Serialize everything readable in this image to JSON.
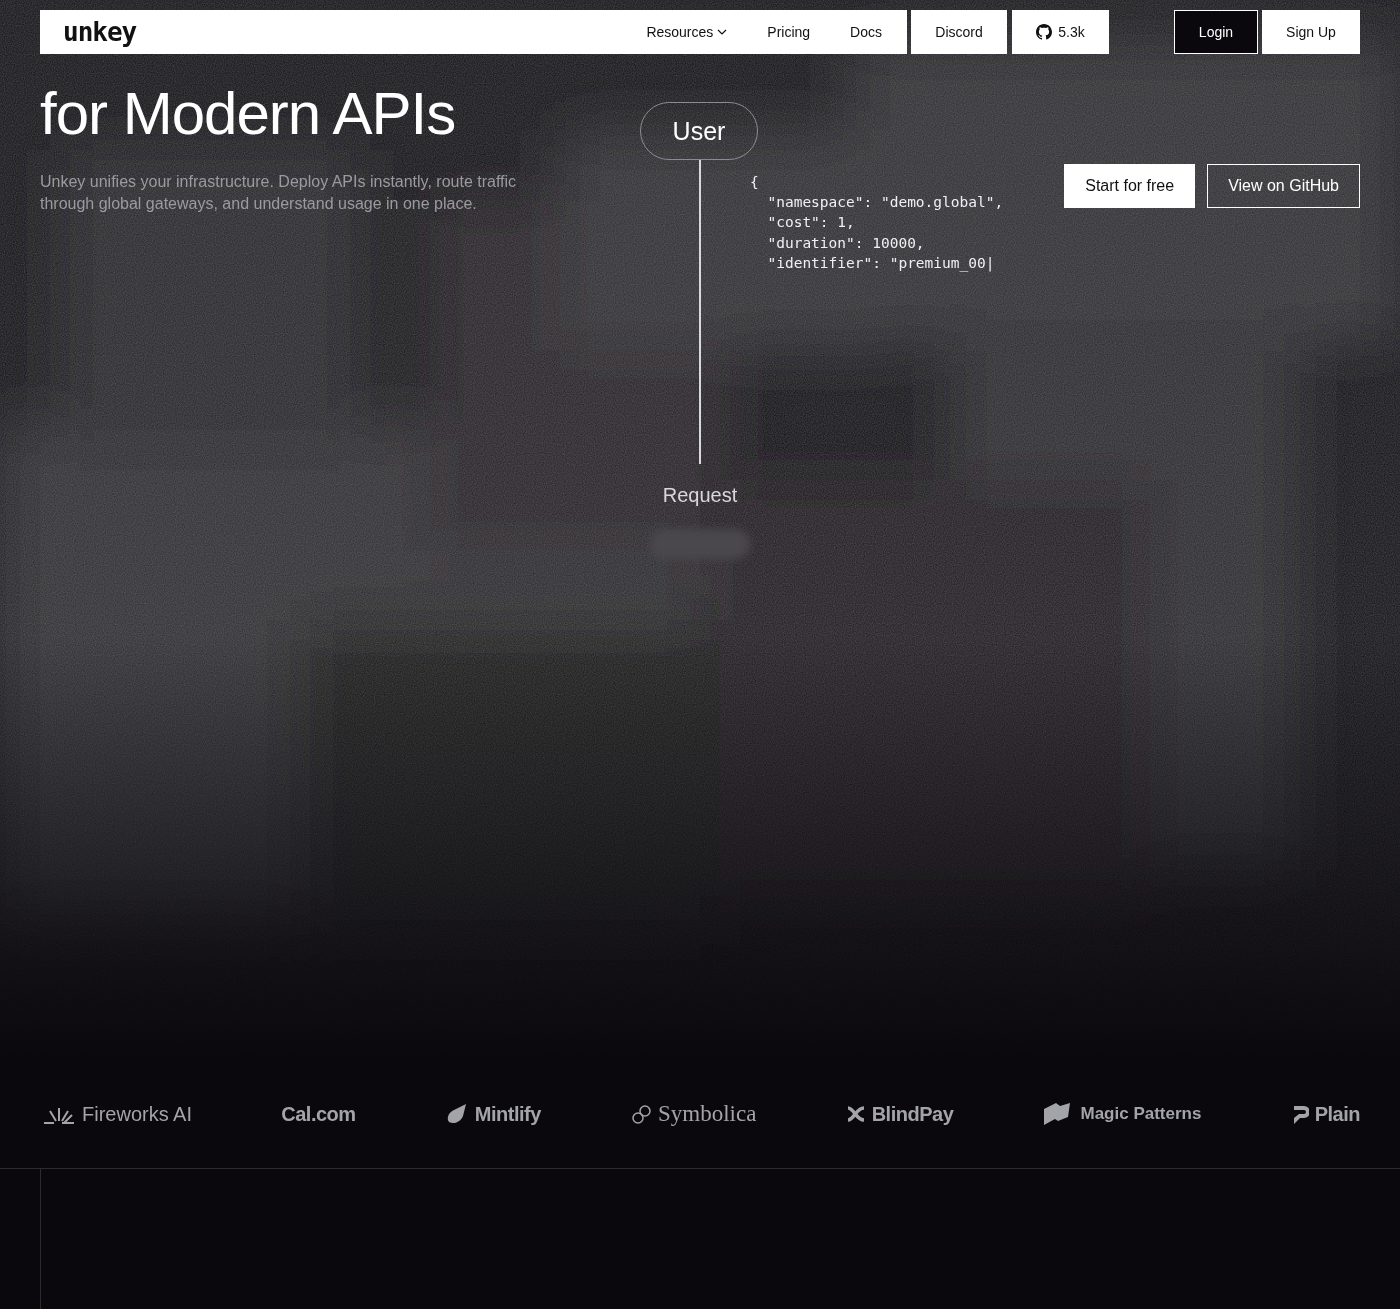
{
  "nav": {
    "logo": "unkey",
    "links": [
      {
        "label": "Resources",
        "dropdown": true
      },
      {
        "label": "Pricing",
        "dropdown": false
      },
      {
        "label": "Docs",
        "dropdown": false
      }
    ],
    "boxed": [
      {
        "kind": "text",
        "label": "Discord"
      },
      {
        "kind": "github",
        "label": "5.3k"
      }
    ],
    "auth": [
      {
        "label": "Login",
        "selected": true
      },
      {
        "label": "Sign Up",
        "selected": false
      }
    ]
  },
  "hero": {
    "background": {
      "kind": "picture"
    },
    "title_lines": [
      "for Modern APIs"
    ],
    "subtitle": "Unkey unifies your infrastructure. Deploy APIs instantly, route traffic through global gateways, and understand usage in one place.",
    "diagram": {
      "top_node": "User",
      "code_lines": [
        "{",
        "  \"namespace\": \"demo.global\",",
        "  \"cost\": 1,",
        "  \"duration\": 10000,",
        "  \"identifier\": \"premium_00|"
      ],
      "bottom_label": "Request"
    },
    "buttons": [
      {
        "label": "Start for free",
        "kind": "primary"
      },
      {
        "label": "View on GitHub",
        "kind": "outline"
      }
    ]
  },
  "logos": [
    {
      "name": "Fireworks AI",
      "kind": "fireworks"
    },
    {
      "name": "Cal.com",
      "kind": "none"
    },
    {
      "name": "Mintlify",
      "kind": "mintlify"
    },
    {
      "name": "Symbolica",
      "kind": "symbolica"
    },
    {
      "name": "BlindPay",
      "kind": "blindpay"
    },
    {
      "name": "Magic Patterns",
      "kind": "magic"
    },
    {
      "name": "Plain",
      "kind": "plain"
    }
  ]
}
